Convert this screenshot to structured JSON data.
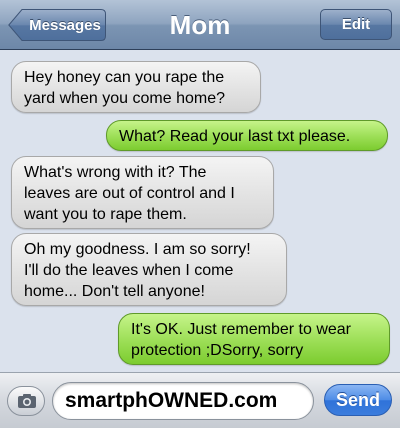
{
  "navbar": {
    "title": "Mom",
    "back_label": "Messages",
    "edit_label": "Edit"
  },
  "messages": [
    {
      "direction": "incoming",
      "text": "Hey honey can you rape the\nyard when you come home?"
    },
    {
      "direction": "outgoing",
      "text": "What? Read your last txt please."
    },
    {
      "direction": "incoming",
      "text": "What's wrong with it? The\nleaves are out of control and I\nwant you to rape them."
    },
    {
      "direction": "incoming",
      "text": "Oh my goodness. I am so sorry!\nI'll do the leaves when I come\nhome... Don't tell anyone!"
    },
    {
      "direction": "outgoing",
      "text": "It's OK. Just remember to wear\nprotection ;DSorry, sorry"
    }
  ],
  "composer": {
    "input_value": "smartphOWNED.com",
    "send_label": "Send",
    "camera_icon": "camera-icon"
  },
  "colors": {
    "navbar": "#7c95b3",
    "incoming_bubble": "#e4e4e4",
    "outgoing_bubble": "#9fe05a",
    "send_button": "#3b7ddd"
  }
}
